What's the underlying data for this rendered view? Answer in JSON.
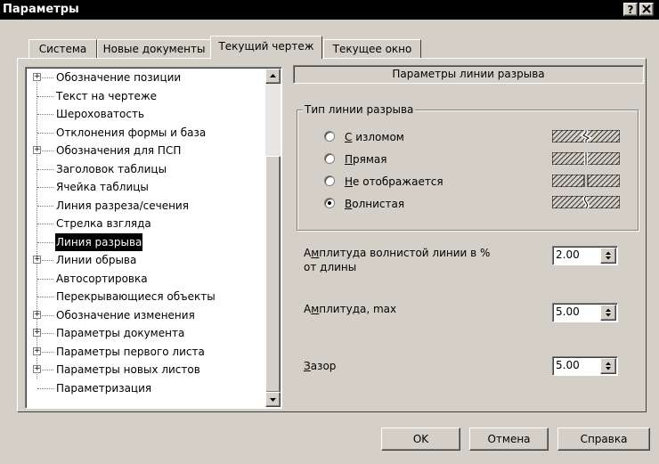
{
  "window": {
    "title": "Параметры",
    "help_btn": "?",
    "close_btn": "X"
  },
  "tabs": [
    {
      "label": "Система"
    },
    {
      "label": "Новые документы"
    },
    {
      "label": "Текущий чертеж",
      "active": true
    },
    {
      "label": "Текущее окно"
    }
  ],
  "tree": {
    "items": [
      {
        "label": "Обозначение позиции",
        "expandable": true
      },
      {
        "label": "Текст на чертеже"
      },
      {
        "label": "Шероховатость"
      },
      {
        "label": "Отклонения формы и база"
      },
      {
        "label": "Обозначения для ПСП",
        "expandable": true
      },
      {
        "label": "Заголовок таблицы"
      },
      {
        "label": "Ячейка таблицы"
      },
      {
        "label": "Линия разреза/сечения"
      },
      {
        "label": "Стрелка взгляда"
      },
      {
        "label": "Линия разрыва",
        "selected": true
      },
      {
        "label": "Линии обрыва",
        "expandable": true
      },
      {
        "label": "Автосортировка"
      },
      {
        "label": "Перекрывающиеся объекты"
      },
      {
        "label": "Обозначение изменения",
        "expandable": true
      },
      {
        "label": "Параметры документа",
        "expandable": true
      },
      {
        "label": "Параметры первого листа",
        "expandable": true
      },
      {
        "label": "Параметры новых листов",
        "expandable": true
      },
      {
        "label": "Параметризация"
      }
    ]
  },
  "panel": {
    "header": "Параметры линии разрыва",
    "group_title": "Тип линии разрыва",
    "options": [
      {
        "key": "С",
        "rest": " изломом",
        "checked": false
      },
      {
        "key": "П",
        "rest": "рямая",
        "checked": false
      },
      {
        "key": "Н",
        "rest": "е отображается",
        "checked": false
      },
      {
        "key": "В",
        "rest": "олнистая",
        "checked": true
      }
    ],
    "amplitude_label_line1_pre": "А",
    "amplitude_label_line1_key": "м",
    "amplitude_label_line1_post": "плитуда волнистой линии в %",
    "amplitude_label_line2": "от длины",
    "amplitude_value": "2.00",
    "amplitude_max_pre": "А",
    "amplitude_max_key": "м",
    "amplitude_max_post": "плитуда, max",
    "amplitude_max_value": "5.00",
    "gap_key": "З",
    "gap_post": "азор",
    "gap_value": "5.00"
  },
  "buttons": {
    "ok": "OK",
    "cancel": "Отмена",
    "help": "Справка"
  }
}
